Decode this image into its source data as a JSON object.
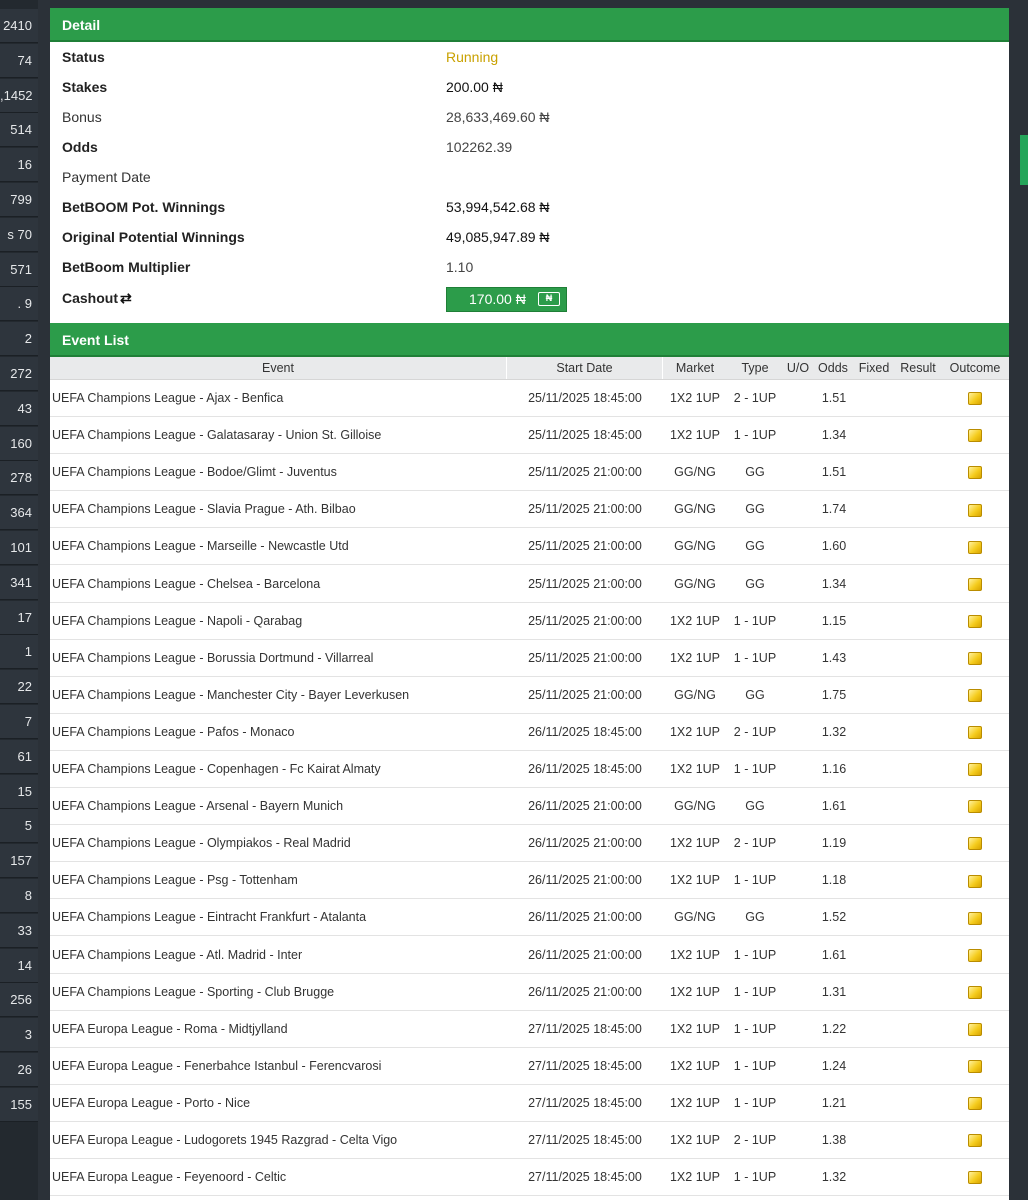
{
  "sidebar": {
    "items": [
      "2410",
      "74",
      ",1452",
      "514",
      "16",
      "799",
      "s 70",
      "571",
      ".  9",
      "2",
      "272",
      "43",
      "160",
      "278",
      "364",
      "101",
      "341",
      "17",
      "1",
      "22",
      "7",
      "61",
      "15",
      "5",
      "157",
      "8",
      "33",
      "14",
      "256",
      "3",
      "26",
      "155"
    ]
  },
  "detail": {
    "header": "Detail",
    "status_label": "Status",
    "status_value": "Running",
    "stakes_label": "Stakes",
    "stakes_value": "200.00 ₦",
    "bonus_label": "Bonus",
    "bonus_value": "28,633,469.60 ₦",
    "odds_label": "Odds",
    "odds_value": "102262.39",
    "payment_date_label": "Payment Date",
    "payment_date_value": "",
    "pot_winnings_label": "BetBOOM Pot. Winnings",
    "pot_winnings_value": "53,994,542.68 ₦",
    "orig_winnings_label": "Original Potential Winnings",
    "orig_winnings_value": "49,085,947.89 ₦",
    "multiplier_label": "BetBoom Multiplier",
    "multiplier_value": "1.10",
    "cashout_label": "Cashout",
    "cashout_value": "170.00 ₦"
  },
  "events": {
    "header": "Event List",
    "columns": [
      "Event",
      "Start Date",
      "Market",
      "Type",
      "U/O",
      "Odds",
      "Fixed",
      "Result",
      "Outcome"
    ],
    "rows": [
      {
        "event": "UEFA Champions League - Ajax - Benfica",
        "date": "25/11/2025 18:45:00",
        "market": "1X2 1UP",
        "type": "2 - 1UP",
        "odds": "1.51"
      },
      {
        "event": "UEFA Champions League - Galatasaray - Union St. Gilloise",
        "date": "25/11/2025 18:45:00",
        "market": "1X2 1UP",
        "type": "1 - 1UP",
        "odds": "1.34"
      },
      {
        "event": "UEFA Champions League - Bodoe/Glimt - Juventus",
        "date": "25/11/2025 21:00:00",
        "market": "GG/NG",
        "type": "GG",
        "odds": "1.51"
      },
      {
        "event": "UEFA Champions League - Slavia Prague - Ath. Bilbao",
        "date": "25/11/2025 21:00:00",
        "market": "GG/NG",
        "type": "GG",
        "odds": "1.74"
      },
      {
        "event": "UEFA Champions League - Marseille - Newcastle Utd",
        "date": "25/11/2025 21:00:00",
        "market": "GG/NG",
        "type": "GG",
        "odds": "1.60"
      },
      {
        "event": "UEFA Champions League - Chelsea - Barcelona",
        "date": "25/11/2025 21:00:00",
        "market": "GG/NG",
        "type": "GG",
        "odds": "1.34"
      },
      {
        "event": "UEFA Champions League - Napoli - Qarabag",
        "date": "25/11/2025 21:00:00",
        "market": "1X2 1UP",
        "type": "1 - 1UP",
        "odds": "1.15"
      },
      {
        "event": "UEFA Champions League - Borussia Dortmund - Villarreal",
        "date": "25/11/2025 21:00:00",
        "market": "1X2 1UP",
        "type": "1 - 1UP",
        "odds": "1.43"
      },
      {
        "event": "UEFA Champions League - Manchester City - Bayer Leverkusen",
        "date": "25/11/2025 21:00:00",
        "market": "GG/NG",
        "type": "GG",
        "odds": "1.75"
      },
      {
        "event": "UEFA Champions League - Pafos - Monaco",
        "date": "26/11/2025 18:45:00",
        "market": "1X2 1UP",
        "type": "2 - 1UP",
        "odds": "1.32"
      },
      {
        "event": "UEFA Champions League - Copenhagen - Fc Kairat Almaty",
        "date": "26/11/2025 18:45:00",
        "market": "1X2 1UP",
        "type": "1 - 1UP",
        "odds": "1.16"
      },
      {
        "event": "UEFA Champions League - Arsenal - Bayern Munich",
        "date": "26/11/2025 21:00:00",
        "market": "GG/NG",
        "type": "GG",
        "odds": "1.61"
      },
      {
        "event": "UEFA Champions League - Olympiakos - Real Madrid",
        "date": "26/11/2025 21:00:00",
        "market": "1X2 1UP",
        "type": "2 - 1UP",
        "odds": "1.19"
      },
      {
        "event": "UEFA Champions League - Psg - Tottenham",
        "date": "26/11/2025 21:00:00",
        "market": "1X2 1UP",
        "type": "1 - 1UP",
        "odds": "1.18"
      },
      {
        "event": "UEFA Champions League - Eintracht Frankfurt - Atalanta",
        "date": "26/11/2025 21:00:00",
        "market": "GG/NG",
        "type": "GG",
        "odds": "1.52"
      },
      {
        "event": "UEFA Champions League - Atl. Madrid - Inter",
        "date": "26/11/2025 21:00:00",
        "market": "1X2 1UP",
        "type": "1 - 1UP",
        "odds": "1.61"
      },
      {
        "event": "UEFA Champions League - Sporting - Club Brugge",
        "date": "26/11/2025 21:00:00",
        "market": "1X2 1UP",
        "type": "1 - 1UP",
        "odds": "1.31"
      },
      {
        "event": "UEFA Europa League - Roma - Midtjylland",
        "date": "27/11/2025 18:45:00",
        "market": "1X2 1UP",
        "type": "1 - 1UP",
        "odds": "1.22"
      },
      {
        "event": "UEFA Europa League - Fenerbahce Istanbul - Ferencvarosi",
        "date": "27/11/2025 18:45:00",
        "market": "1X2 1UP",
        "type": "1 - 1UP",
        "odds": "1.24"
      },
      {
        "event": "UEFA Europa League - Porto - Nice",
        "date": "27/11/2025 18:45:00",
        "market": "1X2 1UP",
        "type": "1 - 1UP",
        "odds": "1.21"
      },
      {
        "event": "UEFA Europa League - Ludogorets 1945 Razgrad - Celta Vigo",
        "date": "27/11/2025 18:45:00",
        "market": "1X2 1UP",
        "type": "2 - 1UP",
        "odds": "1.38"
      },
      {
        "event": "UEFA Europa League - Feyenoord - Celtic",
        "date": "27/11/2025 18:45:00",
        "market": "1X2 1UP",
        "type": "1 - 1UP",
        "odds": "1.32"
      }
    ]
  },
  "colors": {
    "header_green": "#2c9c4a",
    "running_gold": "#c9a100",
    "outcome_icon": "#f5cc1e",
    "sidebar_bg": "#2e353d"
  },
  "icons": {
    "cashout_refresh": "refresh-icon",
    "cashout_money": "money-icon",
    "outcome": "pending-outcome-icon"
  }
}
